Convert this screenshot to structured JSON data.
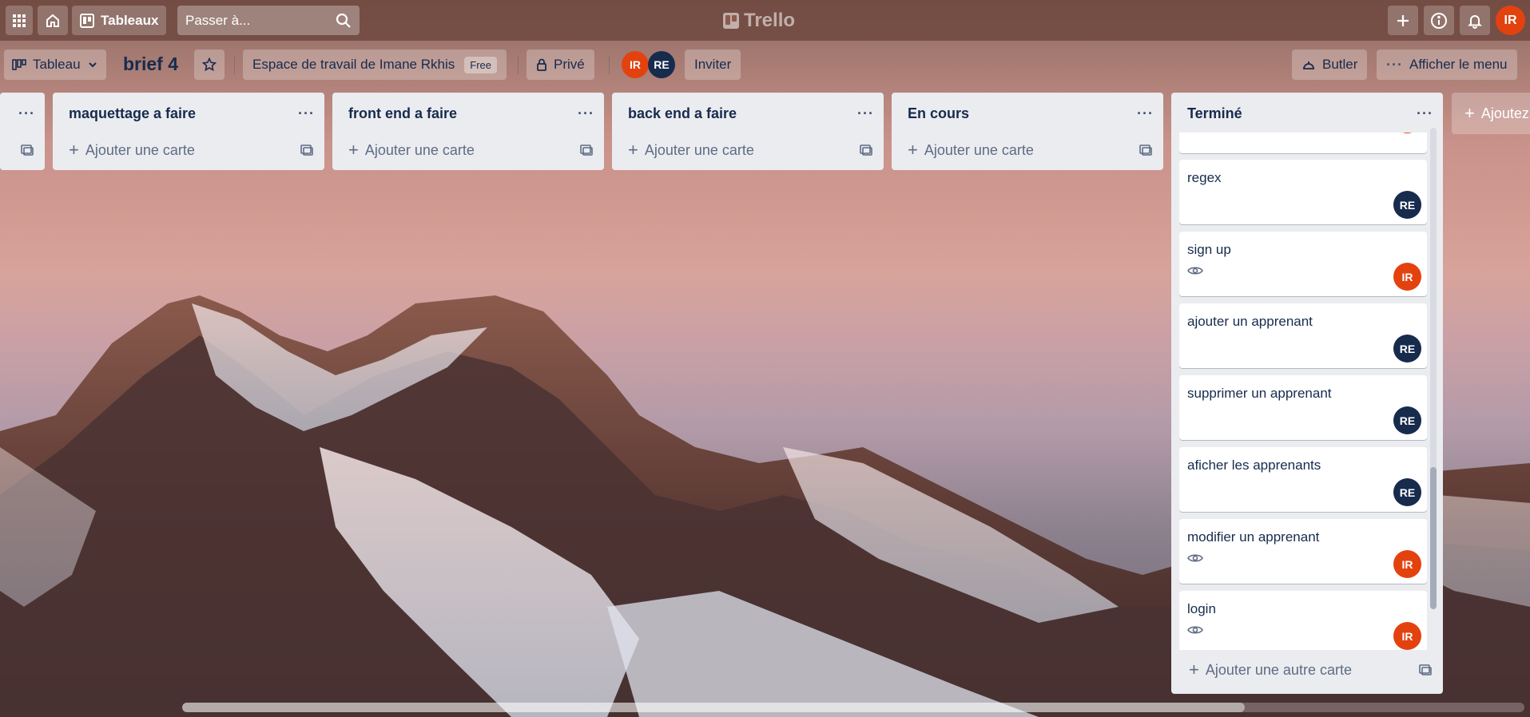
{
  "topbar": {
    "boards_label": "Tableaux",
    "search_placeholder": "Passer à...",
    "logo_text": "Trello",
    "user_initials": "IR"
  },
  "board": {
    "view_label": "Tableau",
    "title": "brief 4",
    "workspace_label": "Espace de travail de Imane Rkhis",
    "workspace_badge": "Free",
    "visibility_label": "Privé",
    "members": [
      "IR",
      "RE"
    ],
    "invite_label": "Inviter",
    "butler_label": "Butler",
    "menu_label": "Afficher le menu"
  },
  "lists": [
    {
      "title": "",
      "add_card_label": ""
    },
    {
      "title": "maquettage a faire",
      "add_card_label": "Ajouter une carte"
    },
    {
      "title": "front end a faire",
      "add_card_label": "Ajouter une carte"
    },
    {
      "title": "back end a faire",
      "add_card_label": "Ajouter une carte"
    },
    {
      "title": "En cours",
      "add_card_label": "Ajouter une carte"
    }
  ],
  "done_list": {
    "title": "Terminé",
    "cards": [
      {
        "title": "regex",
        "watching": false,
        "member": "RE"
      },
      {
        "title": "sign up",
        "watching": true,
        "member": "IR"
      },
      {
        "title": "ajouter un apprenant",
        "watching": false,
        "member": "RE"
      },
      {
        "title": "supprimer un apprenant",
        "watching": false,
        "member": "RE"
      },
      {
        "title": "aficher les apprenants",
        "watching": false,
        "member": "RE"
      },
      {
        "title": "modifier un apprenant",
        "watching": true,
        "member": "IR"
      },
      {
        "title": "login",
        "watching": true,
        "member": "IR"
      }
    ],
    "add_other_label": "Ajouter une autre carte"
  },
  "add_list_label": "Ajoutez",
  "colors": {
    "member_ir": "#e3420f",
    "member_re": "#172b4d",
    "list_bg": "#ebecf0"
  }
}
